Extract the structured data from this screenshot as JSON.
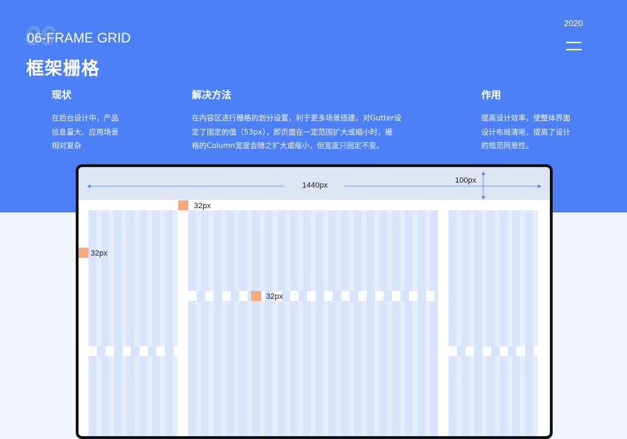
{
  "header": {
    "watermark": "06",
    "subtitle": "06-FRAME GRID",
    "title": "框架栅格",
    "year": "2020"
  },
  "sections": {
    "status": {
      "heading": "现状",
      "lines": [
        "在后台设计中，产品",
        "信息量大、应用场景",
        "相对复杂"
      ]
    },
    "solution": {
      "heading": "解决方法",
      "lines": [
        "在内容区进行栅格的划分设置，利于更多场景搭建，对Gutter设",
        "定了固定的值（53px），即页面在一定范围扩大或缩小时，栅",
        "格的Column宽度会随之扩大或缩小，但宽度只固定不变。"
      ]
    },
    "effect": {
      "heading": "作用",
      "lines": [
        "提高设计效率，使整体界面",
        "设计布局清晰，提高了设计",
        "的规范同意性。"
      ]
    }
  },
  "device": {
    "width_label": "1440px",
    "header_label": "100px",
    "gap_label_top": "32px",
    "gap_label_left": "32px",
    "gap_label_middle": "32px"
  },
  "colors": {
    "hero": "#4d80f6",
    "background": "#f1f5fe",
    "grid_column": "#d7e4fc",
    "marker": "#f7a87c",
    "dimension_line": "#4d80f6"
  }
}
